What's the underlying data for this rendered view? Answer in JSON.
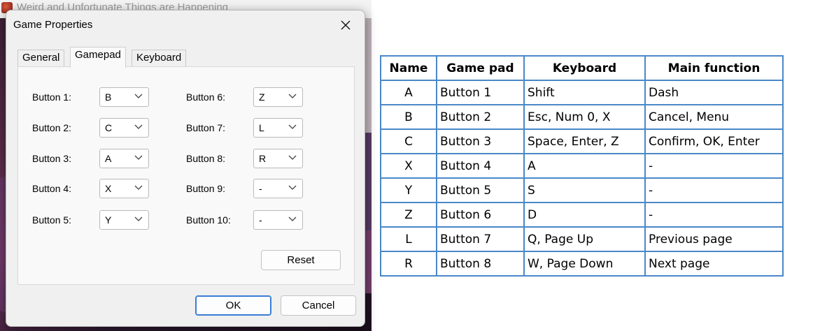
{
  "background_window": {
    "title": "Weird and Unfortunate Things are Happening"
  },
  "dialog": {
    "title": "Game Properties",
    "tabs": [
      {
        "label": "General"
      },
      {
        "label": "Gamepad",
        "active": true
      },
      {
        "label": "Keyboard"
      }
    ],
    "buttons_left": [
      {
        "label": "Button 1:",
        "value": "B"
      },
      {
        "label": "Button 2:",
        "value": "C"
      },
      {
        "label": "Button 3:",
        "value": "A"
      },
      {
        "label": "Button 4:",
        "value": "X"
      },
      {
        "label": "Button 5:",
        "value": "Y"
      }
    ],
    "buttons_right": [
      {
        "label": "Button 6:",
        "value": "Z"
      },
      {
        "label": "Button 7:",
        "value": "L"
      },
      {
        "label": "Button 8:",
        "value": "R"
      },
      {
        "label": "Button 9:",
        "value": "-"
      },
      {
        "label": "Button 10:",
        "value": "-"
      }
    ],
    "reset_label": "Reset",
    "ok_label": "OK",
    "cancel_label": "Cancel"
  },
  "reference_table": {
    "headers": [
      "Name",
      "Game pad",
      "Keyboard",
      "Main function"
    ],
    "rows": [
      [
        "A",
        "Button 1",
        "Shift",
        "Dash"
      ],
      [
        "B",
        "Button 2",
        "Esc, Num 0, X",
        "Cancel, Menu"
      ],
      [
        "C",
        "Button 3",
        "Space, Enter, Z",
        "Confirm, OK, Enter"
      ],
      [
        "X",
        "Button 4",
        "A",
        "-"
      ],
      [
        "Y",
        "Button 5",
        "S",
        "-"
      ],
      [
        "Z",
        "Button 6",
        "D",
        "-"
      ],
      [
        "L",
        "Button 7",
        "Q, Page Up",
        "Previous page"
      ],
      [
        "R",
        "Button 8",
        "W, Page Down",
        "Next page"
      ]
    ]
  },
  "colors": {
    "table_border": "#4a88c8",
    "ok_button_border": "#3a7cd5"
  }
}
